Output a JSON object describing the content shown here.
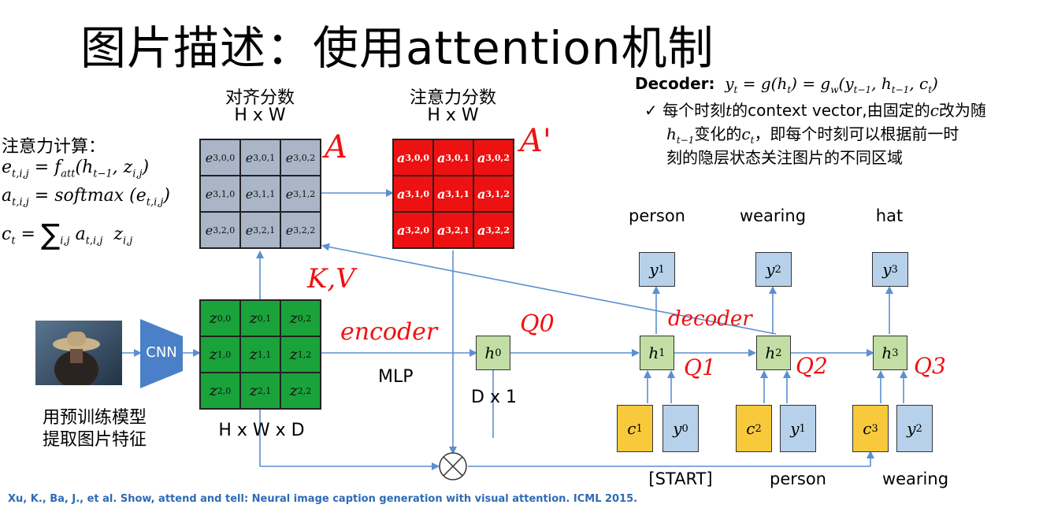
{
  "title": "图片描述：使用attention机制",
  "align_scores": {
    "label": "对齐分数",
    "dims": "H x W"
  },
  "attn_scores": {
    "label": "注意力分数",
    "dims": "H x W"
  },
  "attn_calc": {
    "heading": "注意力计算："
  },
  "decoder": {
    "label": "Decoder:",
    "bullet_check": "✓",
    "line1_prefix": "每个时刻",
    "line1_var": "t",
    "line1_mid": "的context vector,由固定的",
    "line1_var2": "c",
    "line1_suffix": "改为随",
    "line2_suffix": "变化的",
    "line2_rest": "，即每个时刻可以根据前一时",
    "line3": "刻的隐层状态关注图片的不同区域"
  },
  "cnn": {
    "label": "CNN"
  },
  "pretrained_caption": {
    "line1": "用预训练模型",
    "line2": "提取图片特征"
  },
  "features_dims": "H x W x D",
  "mlp_label": "MLP",
  "h0_dims": "D x 1",
  "output_words": [
    "person",
    "wearing",
    "hat"
  ],
  "input_words": [
    "[START]",
    "person",
    "wearing"
  ],
  "handwritten": {
    "A": "A",
    "A_prime": "A'",
    "KV": "K,V",
    "encoder": "encoder",
    "decoder": "decoder",
    "q0": "Q0",
    "q1": "Q1",
    "q2": "Q2",
    "q3": "Q3"
  },
  "reference": "Xu, K., Ba, J., et al. Show, attend and tell: Neural image caption generation with visual attention. ICML 2015.",
  "colors": {
    "alignment_grid": "#aab6c8",
    "attention_grid": "#ee1111",
    "feature_grid": "#1aa33b",
    "hidden_state": "#c2dea4",
    "output_token": "#b7d1ea",
    "context_vector": "#f8c93a",
    "cnn_block": "#4a80c8",
    "arrow": "#5b8fd0",
    "annotation": "#ee1111",
    "reference_text": "#2e6bb3"
  }
}
